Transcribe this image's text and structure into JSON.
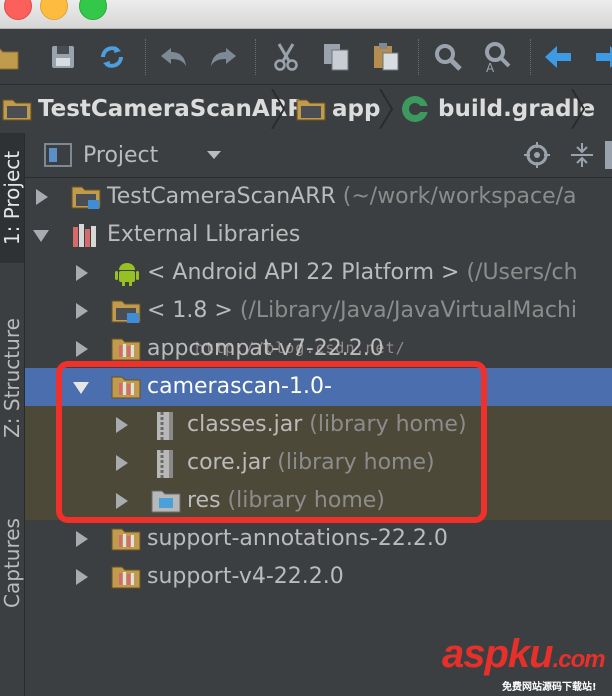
{
  "breadcrumb": {
    "project": "TestCameraScanARR",
    "module": "app",
    "file": "build.gradle"
  },
  "sidebar": {
    "tabs": [
      {
        "label": "1: Project"
      },
      {
        "label": "Z: Structure"
      },
      {
        "label": "Captures"
      }
    ]
  },
  "panel": {
    "title": "Project"
  },
  "tree": {
    "rows": [
      {
        "label": "TestCameraScanARR",
        "sub": " (~/work/workspace/a"
      },
      {
        "label": "External Libraries",
        "sub": ""
      },
      {
        "label": "< Android API 22 Platform >",
        "sub": " (/Users/ch"
      },
      {
        "label": "< 1.8 >",
        "sub": " (/Library/Java/JavaVirtualMachi"
      },
      {
        "label": "appcompat-v7-22.2.0",
        "sub": ""
      },
      {
        "label": "camerascan-1.0-",
        "sub": ""
      },
      {
        "label": "classes.jar",
        "sub": " (library home)"
      },
      {
        "label": "core.jar",
        "sub": " (library home)"
      },
      {
        "label": "res",
        "sub": " (library home)"
      },
      {
        "label": "support-annotations-22.2.0",
        "sub": ""
      },
      {
        "label": "support-v4-22.2.0",
        "sub": ""
      }
    ]
  },
  "watermark": "http://blog.csdn.net/",
  "brand": {
    "logo_a": "aspku",
    "logo_b": ".com",
    "tagline": "免费网站源码下载站!"
  },
  "colors": {
    "selection": "#4b6eaf",
    "highlight_box": "#f0302a",
    "brand_red": "#e8302a"
  }
}
